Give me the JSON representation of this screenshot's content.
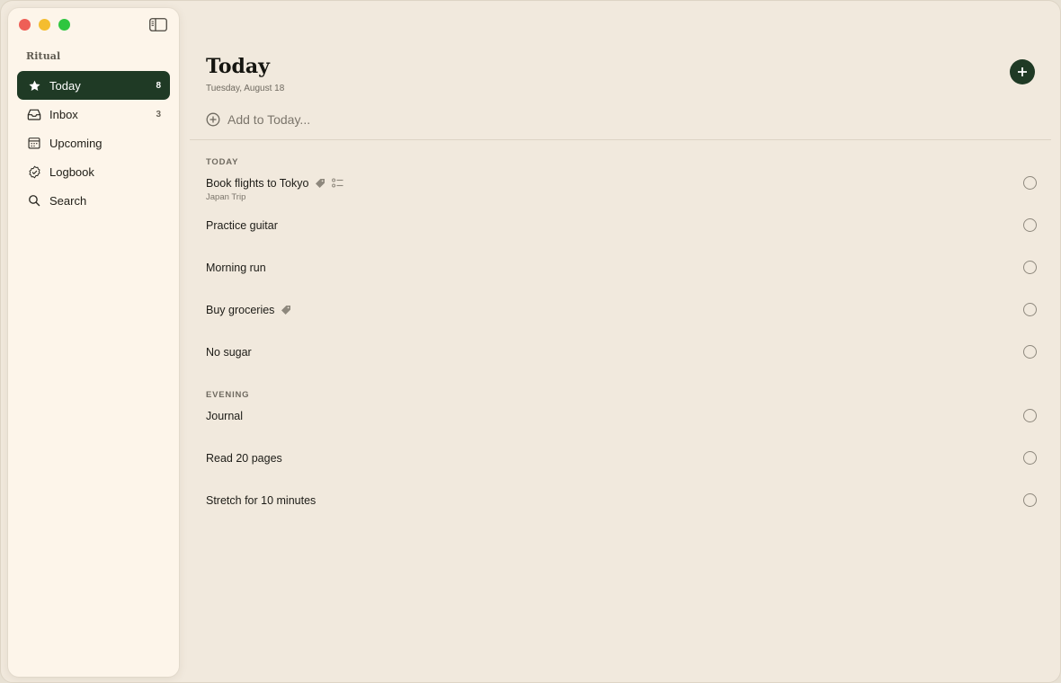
{
  "app": {
    "brand": "Ritual"
  },
  "sidebar": {
    "items": [
      {
        "label": "Today",
        "count": "8",
        "icon": "star-icon",
        "active": true
      },
      {
        "label": "Inbox",
        "count": "3",
        "icon": "inbox-icon",
        "active": false
      },
      {
        "label": "Upcoming",
        "count": "",
        "icon": "calendar-icon",
        "active": false
      },
      {
        "label": "Logbook",
        "count": "",
        "icon": "check-badge-icon",
        "active": false
      },
      {
        "label": "Search",
        "count": "",
        "icon": "search-icon",
        "active": false
      }
    ]
  },
  "main": {
    "title": "Today",
    "date": "Tuesday, August 18",
    "add_placeholder": "Add to Today...",
    "sections": [
      {
        "label": "TODAY",
        "tasks": [
          {
            "title": "Book flights to Tokyo",
            "subtitle": "Japan Trip",
            "tag": true,
            "checklist": true
          },
          {
            "title": "Practice guitar",
            "subtitle": "",
            "tag": false,
            "checklist": false
          },
          {
            "title": "Morning run",
            "subtitle": "",
            "tag": false,
            "checklist": false
          },
          {
            "title": "Buy groceries",
            "subtitle": "",
            "tag": true,
            "checklist": false
          },
          {
            "title": "No sugar",
            "subtitle": "",
            "tag": false,
            "checklist": false
          }
        ]
      },
      {
        "label": "EVENING",
        "tasks": [
          {
            "title": "Journal",
            "subtitle": "",
            "tag": false,
            "checklist": false
          },
          {
            "title": "Read 20 pages",
            "subtitle": "",
            "tag": false,
            "checklist": false
          },
          {
            "title": "Stretch for 10 minutes",
            "subtitle": "",
            "tag": false,
            "checklist": false
          }
        ]
      }
    ]
  },
  "colors": {
    "accent": "#1f3a25",
    "background": "#f1e9dd",
    "sidebar": "#fdf5ea",
    "traffic_red": "#ee5f57",
    "traffic_yellow": "#f4bd2f",
    "traffic_green": "#2fc640"
  }
}
